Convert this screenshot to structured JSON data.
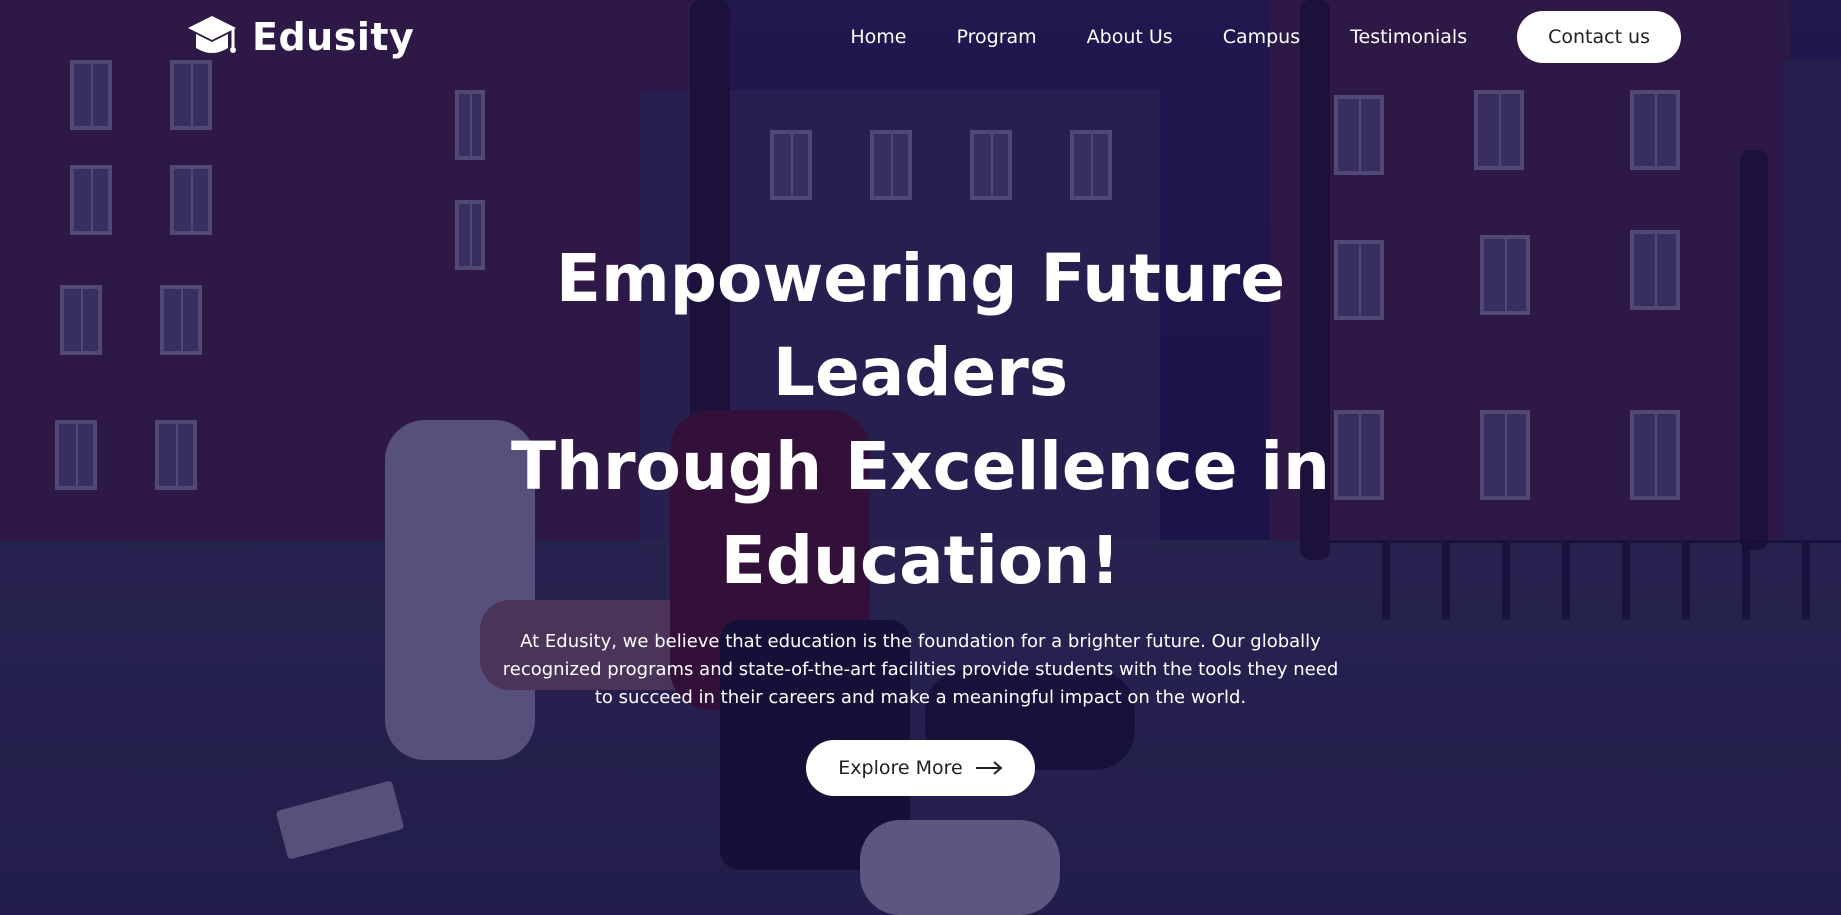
{
  "brand": {
    "name": "Edusity",
    "logo_icon": "graduation-cap-icon"
  },
  "nav": {
    "items": [
      {
        "label": "Home"
      },
      {
        "label": "Program"
      },
      {
        "label": "About Us"
      },
      {
        "label": "Campus"
      },
      {
        "label": "Testimonials"
      }
    ],
    "contact_label": "Contact us"
  },
  "hero": {
    "title_line1": "Empowering Future Leaders",
    "title_line2": "Through Excellence in",
    "title_line3": "Education!",
    "description": "At Edusity, we believe that education is the foundation for a brighter future. Our globally recognized programs and state-of-the-art facilities provide students with the tools they need to succeed in their careers and make a meaningful impact on the world.",
    "cta_label": "Explore More",
    "cta_icon": "arrow-right-icon"
  },
  "colors": {
    "overlay": "#08003a",
    "button_bg": "#ffffff",
    "button_text": "#212121",
    "text": "#ffffff"
  }
}
